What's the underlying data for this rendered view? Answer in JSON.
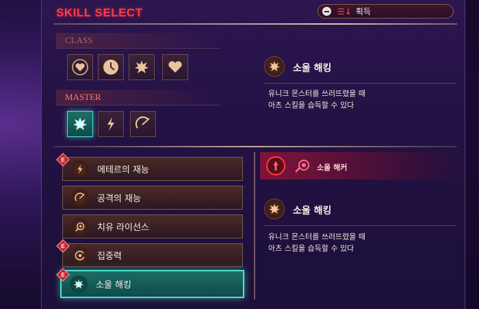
{
  "header": {
    "title": "SKILL SELECT",
    "sort": {
      "minus_icon": "minus-circle-icon",
      "sort_icon": "sort-desc-icon",
      "label": "획득"
    }
  },
  "sections": {
    "class_label": "CLASS",
    "master_label": "MASTER"
  },
  "class_icons": [
    {
      "icon": "heart-ring-icon"
    },
    {
      "icon": "clock-icon"
    },
    {
      "icon": "soul-burst-icon"
    },
    {
      "icon": "heart-icon"
    }
  ],
  "master_icons": [
    {
      "icon": "soul-burst-icon",
      "active": true
    },
    {
      "icon": "lightning-icon"
    },
    {
      "icon": "sword-swipe-icon"
    }
  ],
  "top_detail": {
    "name": "소울 해킹",
    "desc_line1": "유니크 몬스터를 쓰러뜨렸을 때",
    "desc_line2": "아츠 스킬을 습득할 수 있다"
  },
  "skill_list": [
    {
      "label": "에테르의 재능",
      "icon": "lightning-icon",
      "badge": "E"
    },
    {
      "label": "공격의 재능",
      "icon": "sword-swipe-icon",
      "badge": ""
    },
    {
      "label": "치유 라이선스",
      "icon": "heal-target-icon",
      "badge": ""
    },
    {
      "label": "집중력",
      "icon": "focus-swirl-icon",
      "badge": "E"
    },
    {
      "label": "소울 해킹",
      "icon": "soul-burst-icon",
      "badge": "E",
      "selected": true
    }
  ],
  "hacker": {
    "label": "소울 해커"
  },
  "bottom_detail": {
    "name": "소울 해킹",
    "desc_line1": "유니크 몬스터를 쓰러뜨렸을 때",
    "desc_line2": "아츠 스킬을 습득할 수 있다"
  },
  "colors": {
    "accent_red": "#ff3b45",
    "accent_teal": "#4fe4cc"
  }
}
